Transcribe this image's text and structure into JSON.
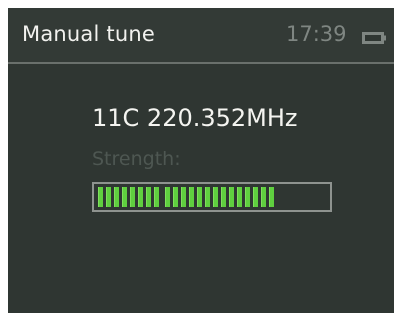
{
  "header": {
    "title": "Manual tune",
    "time": "17:39",
    "battery_icon": "battery-icon"
  },
  "main": {
    "station": "11C 220.352MHz",
    "strength_label": "Strength:",
    "strength_fraction": 0.85
  },
  "colors": {
    "screen_bg": "#2f3632",
    "meter_green": "#5fcf3f",
    "label_dim": "#4e5752"
  }
}
